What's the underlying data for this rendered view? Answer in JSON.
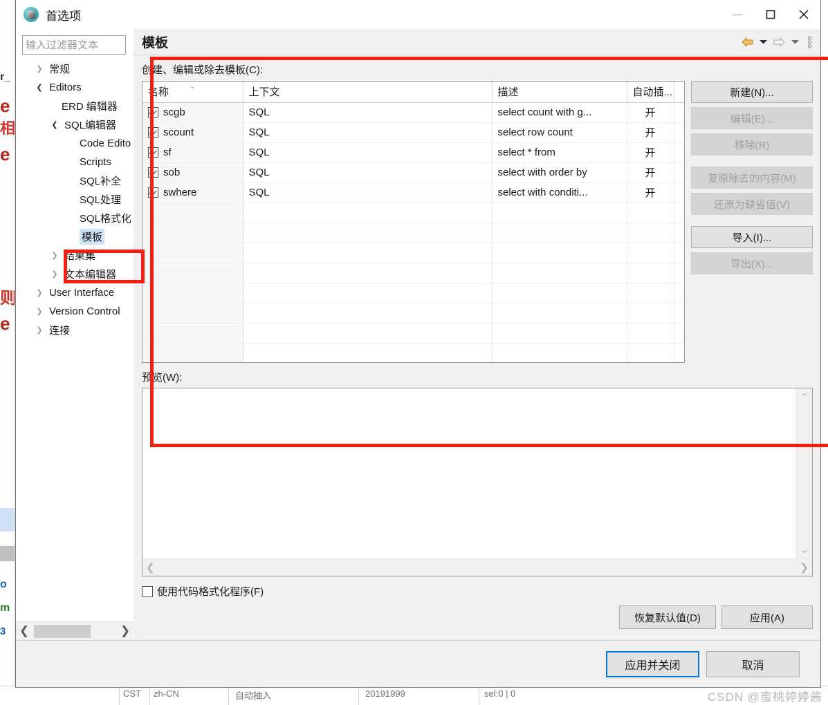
{
  "window": {
    "title": "首选项",
    "icon": "app-globe-icon",
    "controls": {
      "minimize": "minimize-icon",
      "maximize": "maximize-icon",
      "close": "close-icon"
    }
  },
  "sidebar": {
    "filter_placeholder": "输入过滤器文本",
    "filter_value": "",
    "items": [
      {
        "label": "常规",
        "indent": 0,
        "twisty": "collapsed",
        "selected": false
      },
      {
        "label": "Editors",
        "indent": 0,
        "twisty": "expanded",
        "selected": false
      },
      {
        "label": "ERD 编辑器",
        "indent": 1,
        "twisty": "none",
        "selected": false
      },
      {
        "label": "SQL编辑器",
        "indent": 1,
        "twisty": "expanded",
        "selected": false
      },
      {
        "label": "Code Edito",
        "indent": 2,
        "twisty": "none",
        "selected": false
      },
      {
        "label": "Scripts",
        "indent": 2,
        "twisty": "none",
        "selected": false
      },
      {
        "label": "SQL补全",
        "indent": 2,
        "twisty": "none",
        "selected": false
      },
      {
        "label": "SQL处理",
        "indent": 2,
        "twisty": "none",
        "selected": false
      },
      {
        "label": "SQL格式化",
        "indent": 2,
        "twisty": "none",
        "selected": false
      },
      {
        "label": "模板",
        "indent": 2,
        "twisty": "none",
        "selected": true
      },
      {
        "label": "结果集",
        "indent": 1,
        "twisty": "collapsed",
        "selected": false
      },
      {
        "label": "文本编辑器",
        "indent": 1,
        "twisty": "collapsed",
        "selected": false
      },
      {
        "label": "User Interface",
        "indent": 0,
        "twisty": "collapsed",
        "selected": false
      },
      {
        "label": "Version Control",
        "indent": 0,
        "twisty": "collapsed",
        "selected": false
      },
      {
        "label": "连接",
        "indent": 0,
        "twisty": "collapsed",
        "selected": false
      }
    ],
    "hscroll": {
      "left_arrow": "chevron-left-icon",
      "right_arrow": "chevron-right-icon"
    }
  },
  "page": {
    "title": "模板",
    "toolbar": {
      "back": "back-arrow-icon",
      "back_menu": "chevron-down-icon",
      "forward": "forward-arrow-icon",
      "forward_menu": "chevron-down-icon",
      "more": "more-vertical-icon"
    },
    "section_label": "创建、编辑或除去模板(C):",
    "section_label_mnemonic": "C"
  },
  "table": {
    "columns": [
      "名称",
      "上下文",
      "描述",
      "自动插...",
      ""
    ],
    "sort_column": 0,
    "sort_indicator": "chevron-down-icon",
    "rows": [
      {
        "checked": true,
        "name": "scgb",
        "context": "SQL",
        "description": "select count with g...",
        "autoinsert": "开"
      },
      {
        "checked": true,
        "name": "scount",
        "context": "SQL",
        "description": "select row count",
        "autoinsert": "开"
      },
      {
        "checked": true,
        "name": "sf",
        "context": "SQL",
        "description": "select * from",
        "autoinsert": "开"
      },
      {
        "checked": true,
        "name": "sob",
        "context": "SQL",
        "description": "select with order by",
        "autoinsert": "开"
      },
      {
        "checked": true,
        "name": "swhere",
        "context": "SQL",
        "description": "select with conditi...",
        "autoinsert": "开"
      }
    ],
    "empty_row_count": 9
  },
  "side_buttons": [
    {
      "label": "新建(N)...",
      "mnemonic": "N",
      "enabled": true
    },
    {
      "label": "编辑(E)...",
      "mnemonic": "E",
      "enabled": false
    },
    {
      "label": "移除(R)",
      "mnemonic": "R",
      "enabled": false
    },
    {
      "label": "复原除去的内容(M)",
      "mnemonic": "M",
      "enabled": false
    },
    {
      "label": "还原为缺省值(V)",
      "mnemonic": "V",
      "enabled": false
    },
    {
      "label": "导入(I)...",
      "mnemonic": "I",
      "enabled": true
    },
    {
      "label": "导出(X)...",
      "mnemonic": "X",
      "enabled": false
    }
  ],
  "preview": {
    "label": "预览(W):",
    "mnemonic": "W",
    "content": "",
    "scroll_up": "chevron-up-icon",
    "scroll_down": "chevron-down-icon",
    "scroll_left": "chevron-left-icon",
    "scroll_right": "chevron-right-icon"
  },
  "formatter": {
    "label": "使用代码格式化程序(F)",
    "mnemonic": "F",
    "checked": false
  },
  "apply_row": {
    "restore_defaults": "恢复默认值(D)",
    "restore_defaults_mnemonic": "D",
    "apply": "应用(A)",
    "apply_mnemonic": "A"
  },
  "footer": {
    "apply_and_close": "应用并关闭",
    "cancel": "取消"
  },
  "annotations": {
    "content_box_color": "#f41f10",
    "tree_box_color": "#f41f10"
  },
  "watermark": "CSDN @蜜桃婷婷酱",
  "background_status": [
    "CST",
    "zh-CN",
    "",
    "自动抽入",
    "20191999",
    "sel:0 | 0"
  ]
}
